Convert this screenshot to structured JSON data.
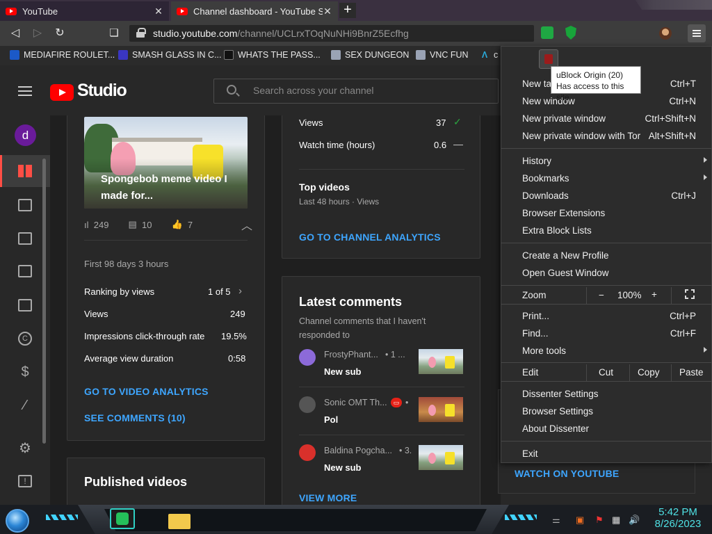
{
  "tabs": [
    {
      "label": "YouTube",
      "close": "✕"
    },
    {
      "label": "Channel dashboard - YouTube Stu",
      "close": "✕"
    }
  ],
  "new_tab_symbol": "+",
  "url": {
    "host": "studio.youtube.com",
    "path": "/channel/UCLrxTOqNuNHi9BnrZ5Ecfhg"
  },
  "bookmarks": [
    {
      "label": "MEDIAFIRE ROULET...",
      "icon": "mediafire-icon",
      "color": "#1b59c8"
    },
    {
      "label": "SMASH GLASS IN C...",
      "icon": "glass-icon",
      "color": "#3a36c2"
    },
    {
      "label": "WHATS THE PASS...",
      "icon": "terminal-icon",
      "color": "#222222"
    },
    {
      "label": "SEX DUNGEON",
      "icon": "cube-icon",
      "color": "#9aa3b5"
    },
    {
      "label": "VNC FUN",
      "icon": "cube-icon",
      "color": "#9aa3b5"
    },
    {
      "label": "c",
      "icon": "a-logo-icon",
      "color": "#2aa9d8"
    }
  ],
  "studio": {
    "logo_text": "Studio",
    "search_placeholder": "Search across your channel",
    "channel_initial": "d"
  },
  "video_card": {
    "thumbnail_title": "Spongebob meme video I made for...",
    "views": "249",
    "comments": "10",
    "likes": "7",
    "period": "First 98 days 3 hours",
    "ranking_label": "Ranking by views",
    "ranking_value": "1 of 5",
    "rows": [
      {
        "label": "Views",
        "value": "249"
      },
      {
        "label": "Impressions click-through rate",
        "value": "19.5%"
      },
      {
        "label": "Average view duration",
        "value": "0:58"
      }
    ],
    "analytics_link": "GO TO VIDEO ANALYTICS",
    "comments_link": "SEE COMMENTS (10)"
  },
  "published": {
    "title": "Published videos"
  },
  "analytics_card": {
    "rows": [
      {
        "label": "Views",
        "value": "37"
      },
      {
        "label": "Watch time (hours)",
        "value": "0.6"
      }
    ],
    "top_videos_title": "Top videos",
    "top_videos_sub": "Last 48 hours · Views",
    "analytics_link": "GO TO CHANNEL ANALYTICS"
  },
  "comments_card": {
    "title": "Latest comments",
    "subtitle": "Channel comments that I haven't responded to",
    "comments": [
      {
        "author": "FrostyPhant...",
        "meta": "• 1 ...",
        "text": "New sub",
        "avatar_color": "#8c6ad9"
      },
      {
        "author": "Sonic OMT Th...",
        "meta": "•",
        "text": "Pol",
        "avatar_color": "#555555"
      },
      {
        "author": "Baldina Pogcha...",
        "meta": "• 3.",
        "text": "New sub",
        "avatar_color": "#d9302b"
      }
    ],
    "view_more": "VIEW MORE"
  },
  "watch_link": "WATCH ON YOUTUBE",
  "tooltip": {
    "line1": "uBlock Origin (20)",
    "line2": "Has access to this site"
  },
  "menu": {
    "items1": [
      {
        "label": "New tab",
        "shortcut": "Ctrl+T"
      },
      {
        "label": "New window",
        "shortcut": "Ctrl+N"
      },
      {
        "label": "New private window",
        "shortcut": "Ctrl+Shift+N"
      },
      {
        "label": "New private window with Tor",
        "shortcut": "Alt+Shift+N"
      }
    ],
    "items2": [
      {
        "label": "History",
        "shortcut": "",
        "submenu": true
      },
      {
        "label": "Bookmarks",
        "shortcut": "",
        "submenu": true
      },
      {
        "label": "Downloads",
        "shortcut": "Ctrl+J"
      },
      {
        "label": "Browser Extensions",
        "shortcut": ""
      },
      {
        "label": "Extra Block Lists",
        "shortcut": ""
      }
    ],
    "items3": [
      {
        "label": "Create a New Profile"
      },
      {
        "label": "Open Guest Window"
      }
    ],
    "zoom": {
      "label": "Zoom",
      "minus": "−",
      "value": "100%",
      "plus": "+"
    },
    "items4": [
      {
        "label": "Print...",
        "shortcut": "Ctrl+P"
      },
      {
        "label": "Find...",
        "shortcut": "Ctrl+F"
      },
      {
        "label": "More tools",
        "shortcut": "",
        "submenu": true
      }
    ],
    "edit": {
      "label": "Edit",
      "cut": "Cut",
      "copy": "Copy",
      "paste": "Paste"
    },
    "items5": [
      {
        "label": "Dissenter Settings"
      },
      {
        "label": "Browser Settings"
      },
      {
        "label": "About Dissenter"
      }
    ],
    "exit": "Exit"
  },
  "taskbar": {
    "time": "5:42 PM",
    "date": "8/26/2023"
  }
}
